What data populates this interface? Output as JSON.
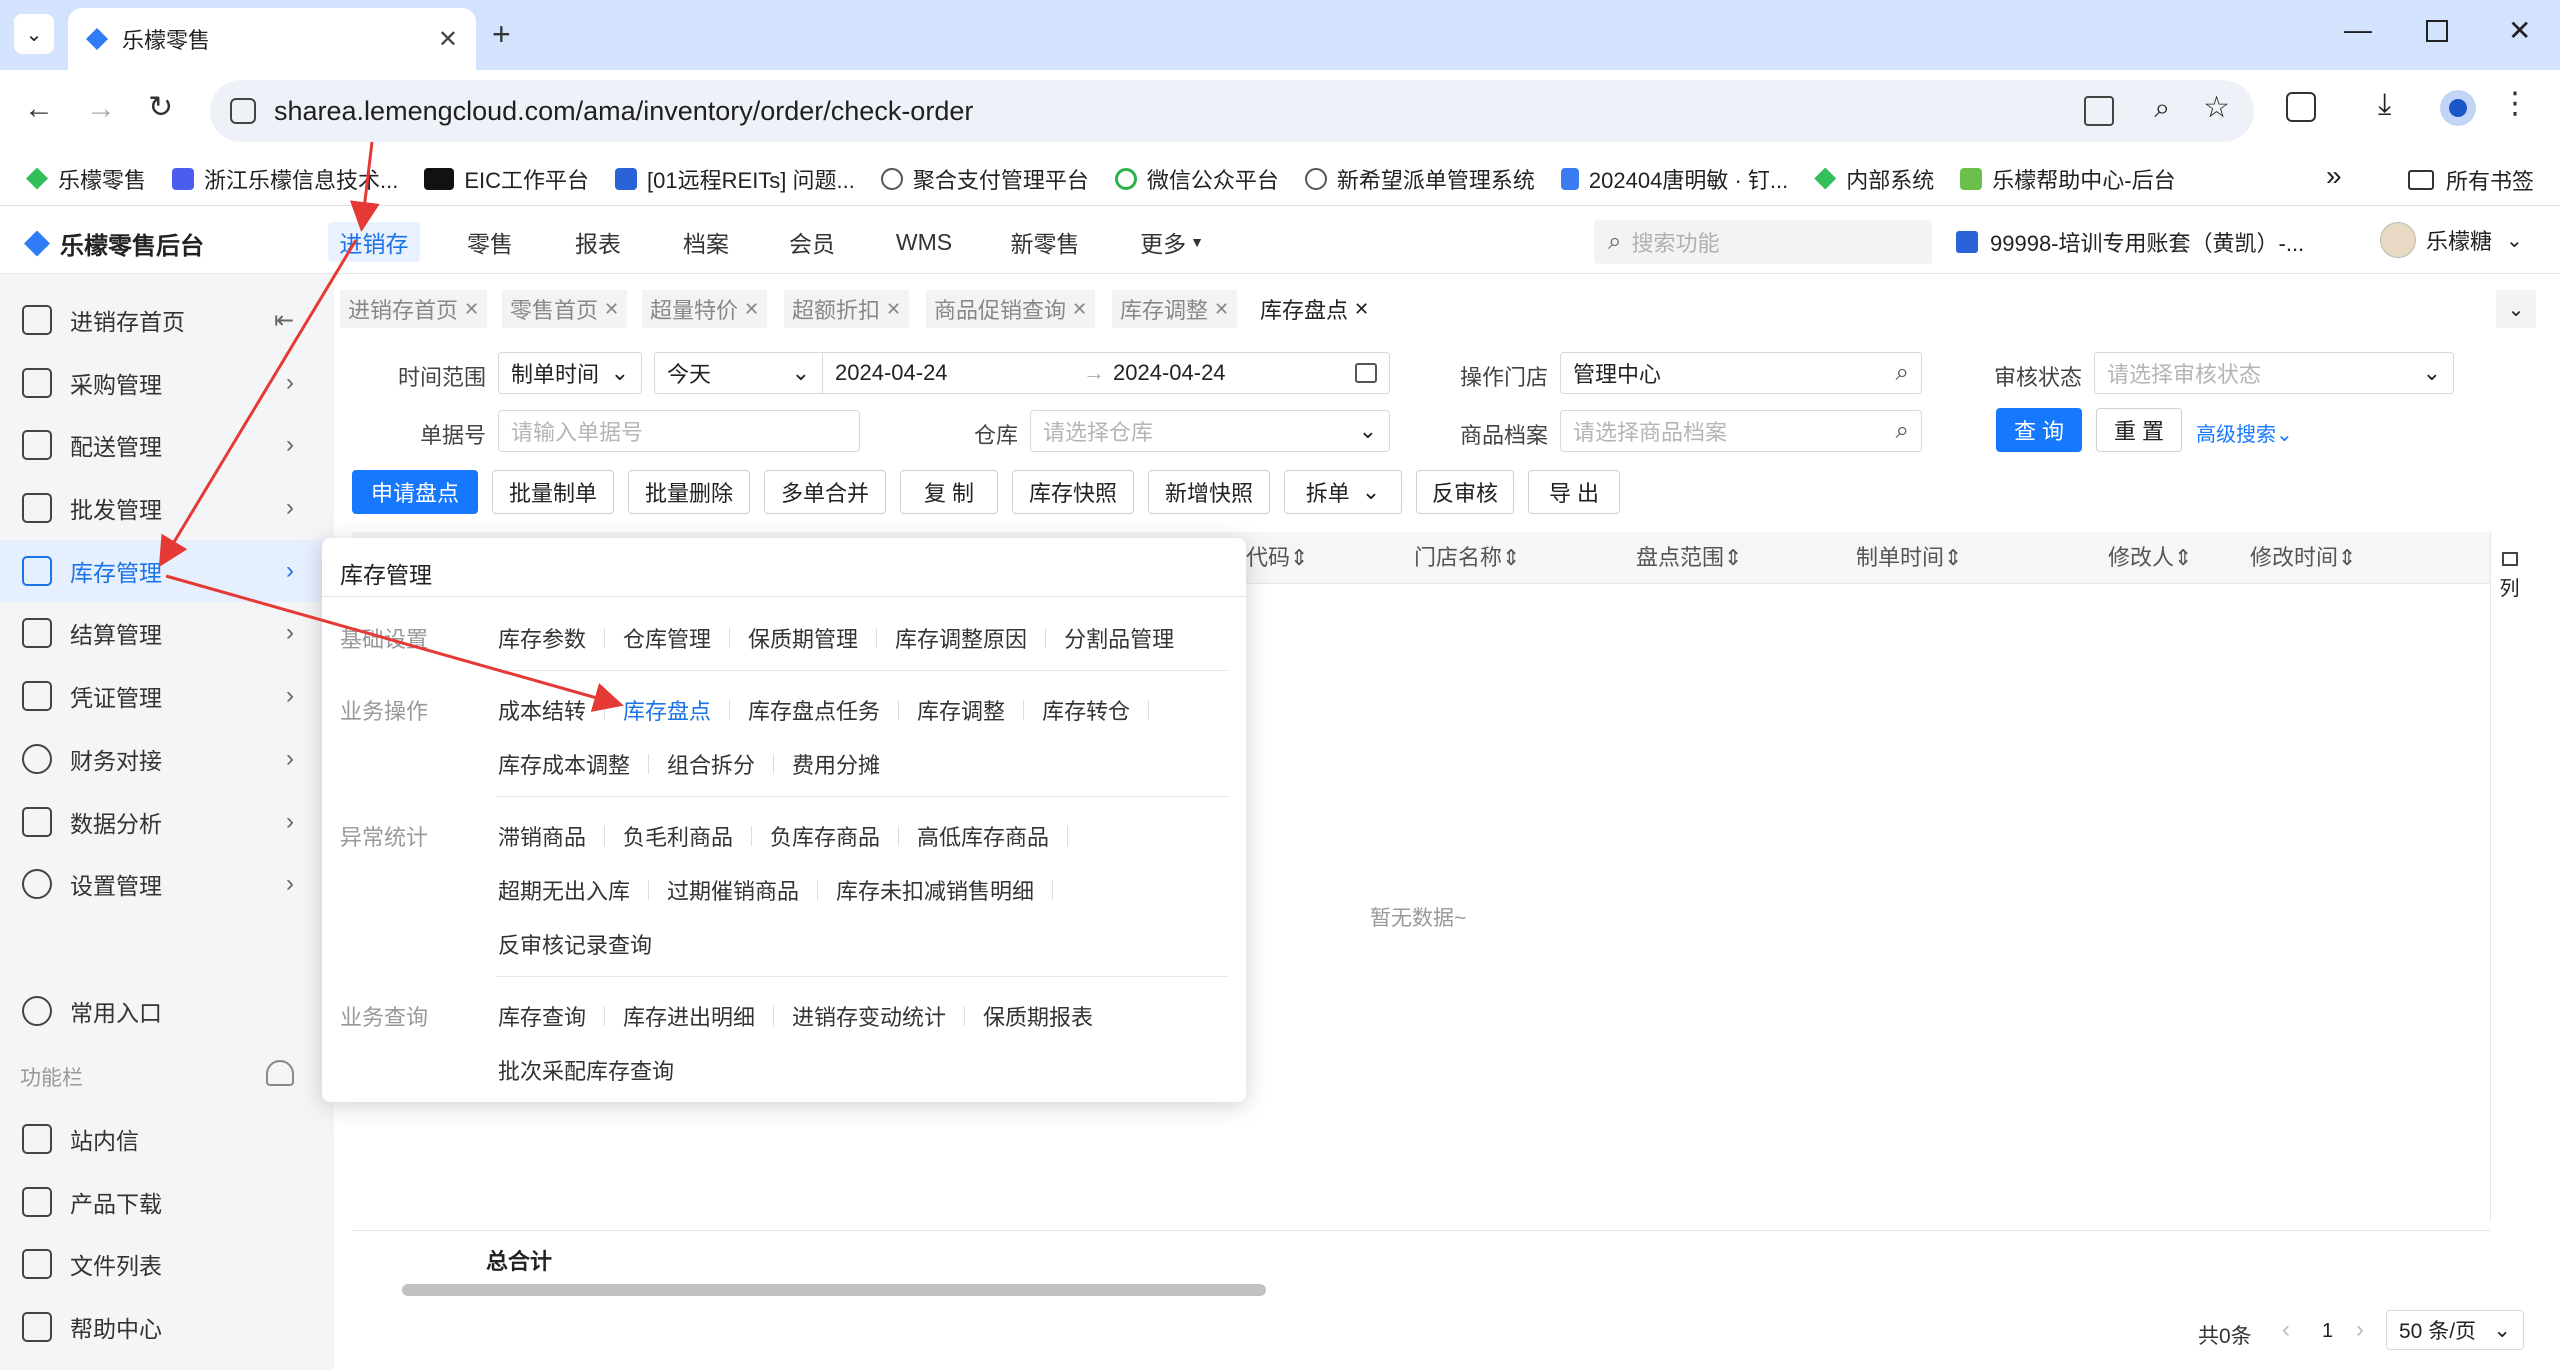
{
  "browser": {
    "tab_title": "乐檬零售",
    "url": "sharea.lemengcloud.com/ama/inventory/order/check-order",
    "bookmarks": [
      "乐檬零售",
      "浙江乐檬信息技术...",
      "EIC工作平台",
      "[01远程REITs] 问题...",
      "聚合支付管理平台",
      "微信公众平台",
      "新希望派单管理系统",
      "202404唐明敏 · 钉...",
      "内部系统",
      "乐檬帮助中心-后台"
    ],
    "all_bookmarks": "所有书签",
    "overflow": "»"
  },
  "header": {
    "logo": "乐檬零售后台",
    "nav": [
      "进销存",
      "零售",
      "报表",
      "档案",
      "会员",
      "WMS",
      "新零售",
      "更多"
    ],
    "search_placeholder": "搜索功能",
    "account": "99998-培训专用账套（黄凯）-...",
    "user": "乐檬糖"
  },
  "sidebar": {
    "items": [
      "进销存首页",
      "采购管理",
      "配送管理",
      "批发管理",
      "库存管理",
      "结算管理",
      "凭证管理",
      "财务对接",
      "数据分析",
      "设置管理"
    ],
    "common": "常用入口",
    "tools_label": "功能栏",
    "tools": [
      "站内信",
      "产品下载",
      "文件列表",
      "帮助中心"
    ]
  },
  "tabs": [
    "进销存首页",
    "零售首页",
    "超量特价",
    "超额折扣",
    "商品促销查询",
    "库存调整",
    "库存盘点"
  ],
  "filters": {
    "time_range_label": "时间范围",
    "time_type": "制单时间",
    "time_preset": "今天",
    "date_start": "2024-04-24",
    "date_end": "2024-04-24",
    "store_label": "操作门店",
    "store_value": "管理中心",
    "audit_label": "审核状态",
    "audit_placeholder": "请选择审核状态",
    "order_no_label": "单据号",
    "order_no_placeholder": "请输入单据号",
    "warehouse_label": "仓库",
    "warehouse_placeholder": "请选择仓库",
    "product_label": "商品档案",
    "product_placeholder": "请选择商品档案",
    "query": "查 询",
    "reset": "重 置",
    "advanced": "高级搜索"
  },
  "actions": [
    "申请盘点",
    "批量制单",
    "批量删除",
    "多单合并",
    "复 制",
    "库存快照",
    "新增快照",
    "拆单",
    "反审核",
    "导 出"
  ],
  "table": {
    "columns": [
      "代码",
      "门店名称",
      "盘点范围",
      "制单时间",
      "修改人",
      "修改时间"
    ],
    "column_setting": "列",
    "empty": "暂无数据~",
    "total": "总合计"
  },
  "pagination": {
    "total": "共0条",
    "page": "1",
    "page_size": "50 条/页"
  },
  "dropdown": {
    "title": "库存管理",
    "sections": [
      {
        "name": "基础设置",
        "rows": [
          [
            "库存参数",
            "仓库管理",
            "保质期管理",
            "库存调整原因",
            "分割品管理"
          ]
        ]
      },
      {
        "name": "业务操作",
        "rows": [
          [
            "成本结转",
            "库存盘点",
            "库存盘点任务",
            "库存调整",
            "库存转仓"
          ],
          [
            "库存成本调整",
            "组合拆分",
            "费用分摊"
          ]
        ]
      },
      {
        "name": "异常统计",
        "rows": [
          [
            "滞销商品",
            "负毛利商品",
            "负库存商品",
            "高低库存商品"
          ],
          [
            "超期无出入库",
            "过期催销商品",
            "库存未扣减销售明细"
          ],
          [
            "反审核记录查询"
          ]
        ]
      },
      {
        "name": "业务查询",
        "rows": [
          [
            "库存查询",
            "库存进出明细",
            "进销存变动统计",
            "保质期报表"
          ],
          [
            "批次采配库存查询"
          ]
        ]
      }
    ]
  },
  "colors": {
    "accent": "#1a73e8",
    "annotation": "#e53935",
    "primary_btn": "#1677ff"
  }
}
